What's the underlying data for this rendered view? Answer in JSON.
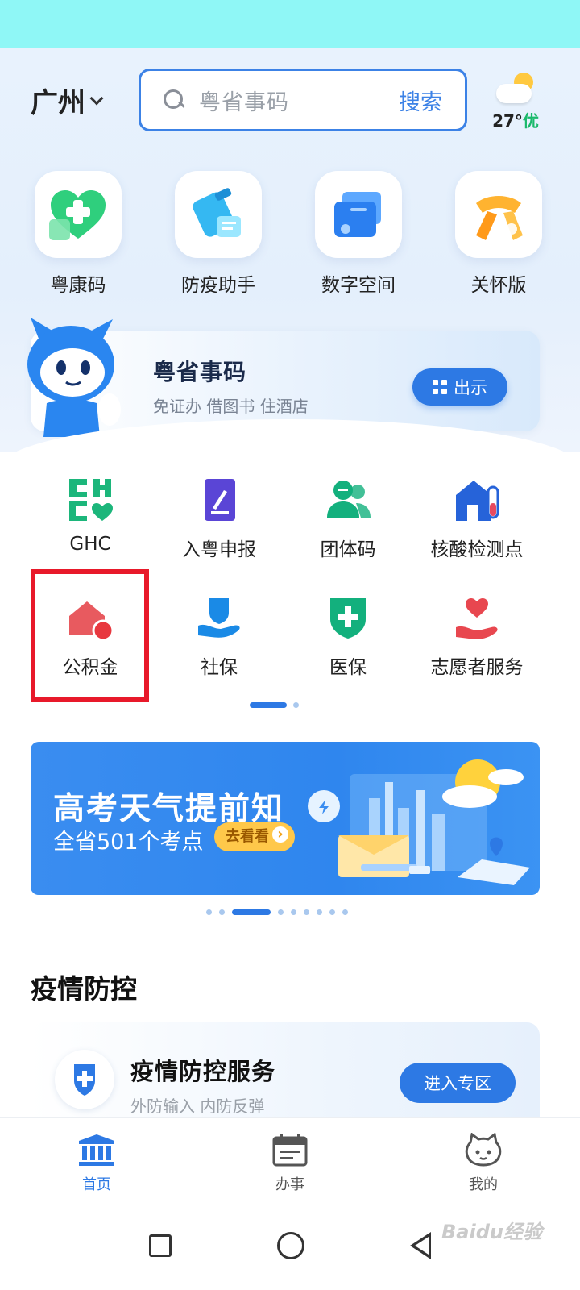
{
  "header": {
    "city": "广州",
    "search_placeholder": "粤省事码",
    "search_button": "搜索",
    "weather": {
      "temp": "27°",
      "air_quality": "优"
    }
  },
  "quick_entries": [
    {
      "label": "粤康码",
      "icon": "health-code-heart-icon"
    },
    {
      "label": "防疫助手",
      "icon": "epidemic-assistant-icon"
    },
    {
      "label": "数字空间",
      "icon": "digital-space-icon"
    },
    {
      "label": "关怀版",
      "icon": "care-edition-icon"
    }
  ],
  "code_banner": {
    "title": "粤省事码",
    "subtitle": "免证办 借图书 住酒店",
    "show_button": "出示"
  },
  "services": [
    {
      "label": "GHC",
      "icon": "ghc-icon"
    },
    {
      "label": "入粤申报",
      "icon": "declaration-icon"
    },
    {
      "label": "团体码",
      "icon": "group-code-icon"
    },
    {
      "label": "核酸检测点",
      "icon": "test-site-icon"
    },
    {
      "label": "公积金",
      "icon": "housing-fund-icon"
    },
    {
      "label": "社保",
      "icon": "social-security-icon"
    },
    {
      "label": "医保",
      "icon": "medical-insurance-icon"
    },
    {
      "label": "志愿者服务",
      "icon": "volunteer-icon"
    }
  ],
  "promo": {
    "title": "高考天气提前知",
    "subtitle": "全省501个考点",
    "button": "去看看"
  },
  "section": {
    "title": "疫情防控"
  },
  "epidemic_card": {
    "title": "疫情防控服务",
    "subtitle": "外防输入 内防反弹",
    "button": "进入专区"
  },
  "tabs": [
    {
      "label": "首页",
      "active": true
    },
    {
      "label": "办事",
      "active": false
    },
    {
      "label": "我的",
      "active": false
    }
  ],
  "watermark": "Baidu经验",
  "colors": {
    "accent": "#2d79e4",
    "highlight": "#e8192a",
    "green": "#1bb96b"
  }
}
